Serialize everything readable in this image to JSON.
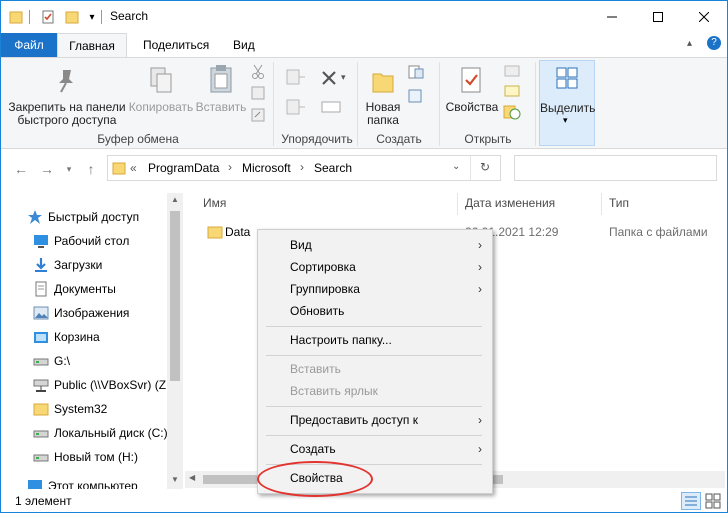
{
  "window": {
    "title": "Search"
  },
  "tabs": {
    "file": "Файл",
    "home": "Главная",
    "share": "Поделиться",
    "view": "Вид"
  },
  "ribbon": {
    "pin_label_1": "Закрепить на панели",
    "pin_label_2": "быстрого доступа",
    "copy": "Копировать",
    "paste": "Вставить",
    "clipboard_group": "Буфер обмена",
    "organize_group": "Упорядочить",
    "new_folder_1": "Новая",
    "new_folder_2": "папка",
    "create_group": "Создать",
    "properties": "Свойства",
    "open_group": "Открыть",
    "select": "Выделить"
  },
  "address": {
    "overflow": "«",
    "crumbs": [
      "ProgramData",
      "Microsoft",
      "Search"
    ]
  },
  "nav_pane": {
    "items": [
      {
        "label": "Быстрый доступ",
        "icon": "star-icon"
      },
      {
        "label": "Рабочий стол",
        "icon": "desktop-icon"
      },
      {
        "label": "Загрузки",
        "icon": "download-icon"
      },
      {
        "label": "Документы",
        "icon": "documents-icon"
      },
      {
        "label": "Изображения",
        "icon": "pictures-icon"
      },
      {
        "label": "Корзина",
        "icon": "recycle-bin-icon"
      },
      {
        "label": "G:\\",
        "icon": "drive-icon"
      },
      {
        "label": "Public (\\\\VBoxSvr) (Z",
        "icon": "network-drive-icon"
      },
      {
        "label": "System32",
        "icon": "folder-icon"
      },
      {
        "label": "Локальный диск (C:)",
        "icon": "drive-icon"
      },
      {
        "label": "Новый том (H:)",
        "icon": "drive-icon"
      },
      {
        "label": "Этот компьютер",
        "icon": "computer-icon"
      }
    ]
  },
  "columns": {
    "name": "Имя",
    "date": "Дата изменения",
    "type": "Тип"
  },
  "files": [
    {
      "name": "Data",
      "date": "26.01.2021 12:29",
      "type": "Папка с файлами"
    }
  ],
  "status": {
    "count": "1 элемент"
  },
  "context_menu": {
    "view": "Вид",
    "sort": "Сортировка",
    "group": "Группировка",
    "refresh": "Обновить",
    "customize": "Настроить папку...",
    "paste": "Вставить",
    "paste_shortcut": "Вставить ярлык",
    "share": "Предоставить доступ к",
    "new": "Создать",
    "properties": "Свойства"
  },
  "colors": {
    "accent": "#1a73c8",
    "highlight_oval": "#e2332f",
    "folder": "#f8d775"
  }
}
